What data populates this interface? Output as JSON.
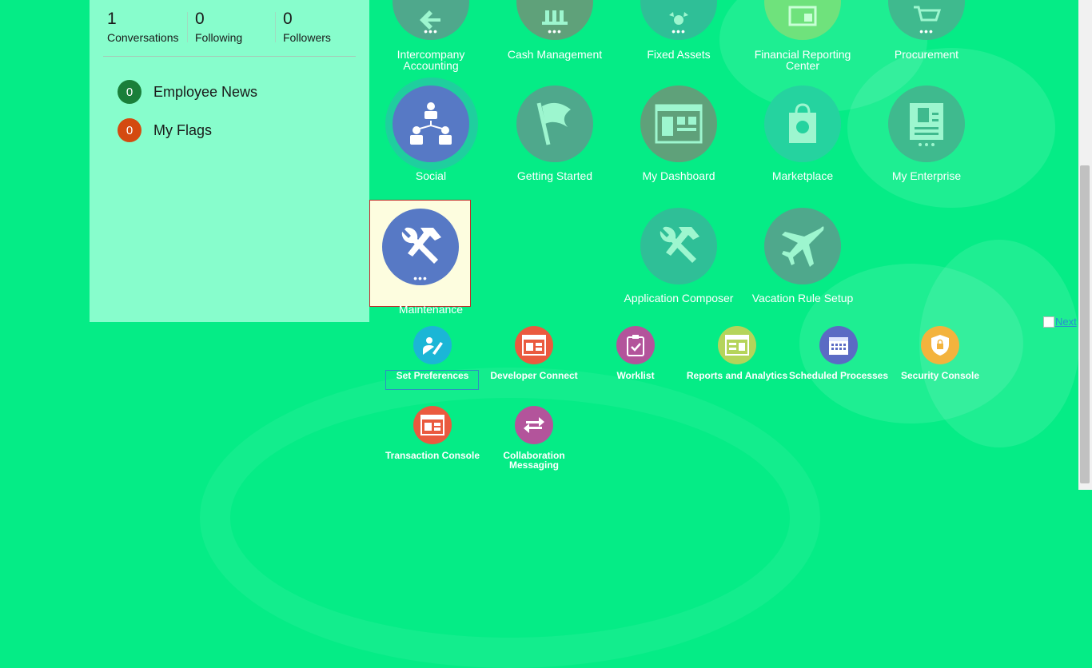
{
  "profile": {
    "stats": [
      {
        "count": "1",
        "label": "Conversations"
      },
      {
        "count": "0",
        "label": "Following"
      },
      {
        "count": "0",
        "label": "Followers"
      }
    ],
    "news": [
      {
        "count": "0",
        "label": "Employee News",
        "color": "#1a7f3a"
      },
      {
        "count": "0",
        "label": "My Flags",
        "color": "#d44a10"
      }
    ]
  },
  "tiles": {
    "row1": [
      {
        "label": "Intercompany Accounting",
        "icon": "intercompany-icon"
      },
      {
        "label": "Cash Management",
        "icon": "bank-icon"
      },
      {
        "label": "Fixed Assets",
        "icon": "fixed-assets-icon"
      },
      {
        "label": "Financial Reporting Center",
        "icon": "report-center-icon"
      },
      {
        "label": "Procurement",
        "icon": "cart-icon"
      }
    ],
    "row2": [
      {
        "label": "Social",
        "icon": "org-chart-icon",
        "color": "#5779c5"
      },
      {
        "label": "Getting Started",
        "icon": "flag-icon",
        "color": "#4fa88c"
      },
      {
        "label": "My Dashboard",
        "icon": "dashboard-icon",
        "color": "#5fa17a"
      },
      {
        "label": "Marketplace",
        "icon": "shopping-bag-icon",
        "color": "#25d39f"
      },
      {
        "label": "My Enterprise",
        "icon": "building-icon",
        "color": "#3fba8e"
      }
    ],
    "row3": [
      {
        "label": "Maintenance",
        "icon": "tools-icon",
        "color": "#5779c5"
      },
      {
        "label": "Application Composer",
        "icon": "tools-icon",
        "color": "#2fbf97"
      },
      {
        "label": "Vacation Rule Setup",
        "icon": "airplane-icon",
        "color": "#4fa88c"
      }
    ]
  },
  "quick_links": [
    {
      "label": "Set Preferences",
      "icon": "preferences-icon",
      "color": "#1bb6d6"
    },
    {
      "label": "Developer Connect",
      "icon": "developer-connect-icon",
      "color": "#ea5a3f"
    },
    {
      "label": "Worklist",
      "icon": "clipboard-check-icon",
      "color": "#b3549b"
    },
    {
      "label": "Reports and Analytics",
      "icon": "reports-icon",
      "color": "#b5d45a"
    },
    {
      "label": "Scheduled Processes",
      "icon": "calendar-icon",
      "color": "#5b6bc4"
    },
    {
      "label": "Security Console",
      "icon": "shield-icon",
      "color": "#f3b33d"
    },
    {
      "label": "Transaction Console",
      "icon": "transaction-console-icon",
      "color": "#ea5a3f"
    },
    {
      "label": "Collaboration Messaging",
      "icon": "exchange-arrows-icon",
      "color": "#b3549b"
    }
  ],
  "next_link": "Next"
}
